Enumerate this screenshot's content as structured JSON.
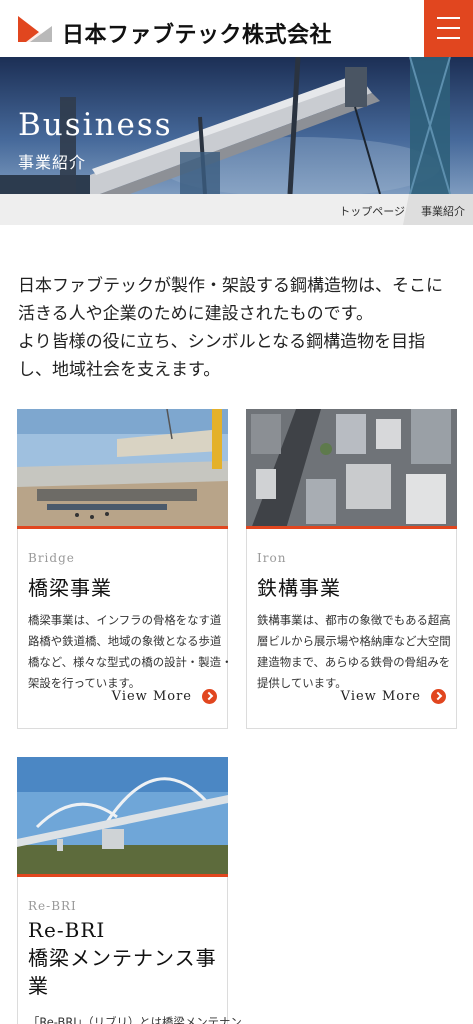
{
  "header": {
    "company_name": "日本ファブテック株式会社",
    "logo_icon": "company-logo-icon",
    "menu_icon": "hamburger-menu-icon",
    "accent_color": "#e1461f"
  },
  "hero": {
    "title": "Business",
    "subtitle": "事業紹介"
  },
  "breadcrumb": {
    "home": "トップページ",
    "current": "事業紹介"
  },
  "intro": {
    "lines": [
      "日本ファブテックが製作・架設する鋼構造物は、そこに",
      "活きる人や企業のために建設されたものです。",
      "より皆様の役に立ち、シンボルとなる鋼構造物を目指",
      "し、地域社会を支えます。"
    ]
  },
  "cards": [
    {
      "en": "Bridge",
      "title": "橋梁事業",
      "desc": [
        "橋梁事業は、インフラの骨格をなす道",
        "路橋や鉄道橋、地域の象徴となる歩道",
        "橋など、様々な型式の橋の設計・製造・",
        "架設を行っています。"
      ],
      "more": "View More"
    },
    {
      "en": "Iron",
      "title": "鉄構事業",
      "desc": [
        "鉄構事業は、都市の象徴でもある超高",
        "層ビルから展示場や格納庫など大空間",
        "建造物まで、あらゆる鉄骨の骨組みを",
        "提供しています。"
      ],
      "more": "View More"
    },
    {
      "en": "Re-BRI",
      "title_lines": [
        "Re-BRI",
        "橋梁メンテナンス事",
        "業"
      ],
      "desc": [
        "「Re-BRI」（リブリ）とは橋梁メンテナン"
      ]
    }
  ]
}
